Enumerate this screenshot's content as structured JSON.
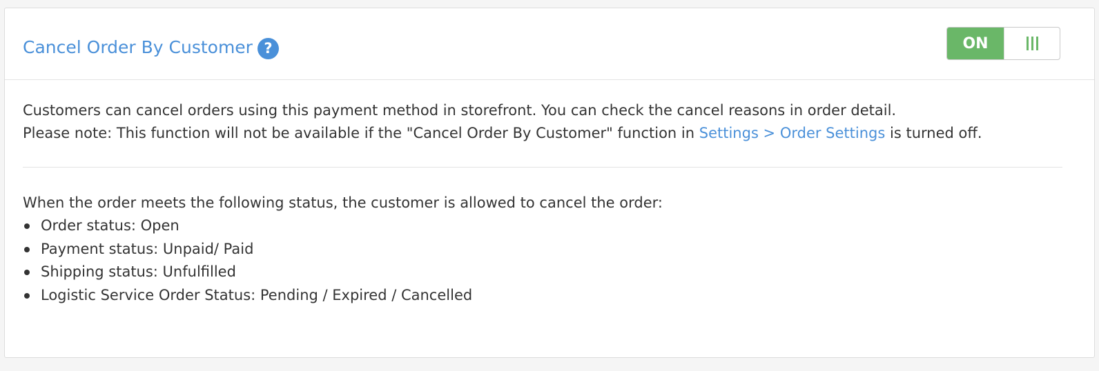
{
  "header": {
    "title": "Cancel Order By Customer",
    "help_icon_glyph": "?",
    "toggle": {
      "state_label": "ON",
      "is_on": true,
      "accent_color": "#6ab768"
    }
  },
  "description": {
    "line1": "Customers can cancel orders using this payment method in storefront. You can check the cancel reasons in order detail.",
    "line2_before": "Please note: This function will not be available if the \"Cancel Order By Customer\" function in ",
    "line2_link": "Settings > Order Settings",
    "line2_after": " is turned off."
  },
  "rules": {
    "intro": "When the order meets the following status, the customer is allowed to cancel the order:",
    "items": [
      "Order status: Open",
      "Payment status: Unpaid/ Paid",
      "Shipping status: Unfulfilled",
      "Logistic Service Order Status: Pending / Expired / Cancelled"
    ]
  },
  "colors": {
    "link": "#4a90d9",
    "toggle_on": "#6ab768",
    "text": "#333333"
  }
}
